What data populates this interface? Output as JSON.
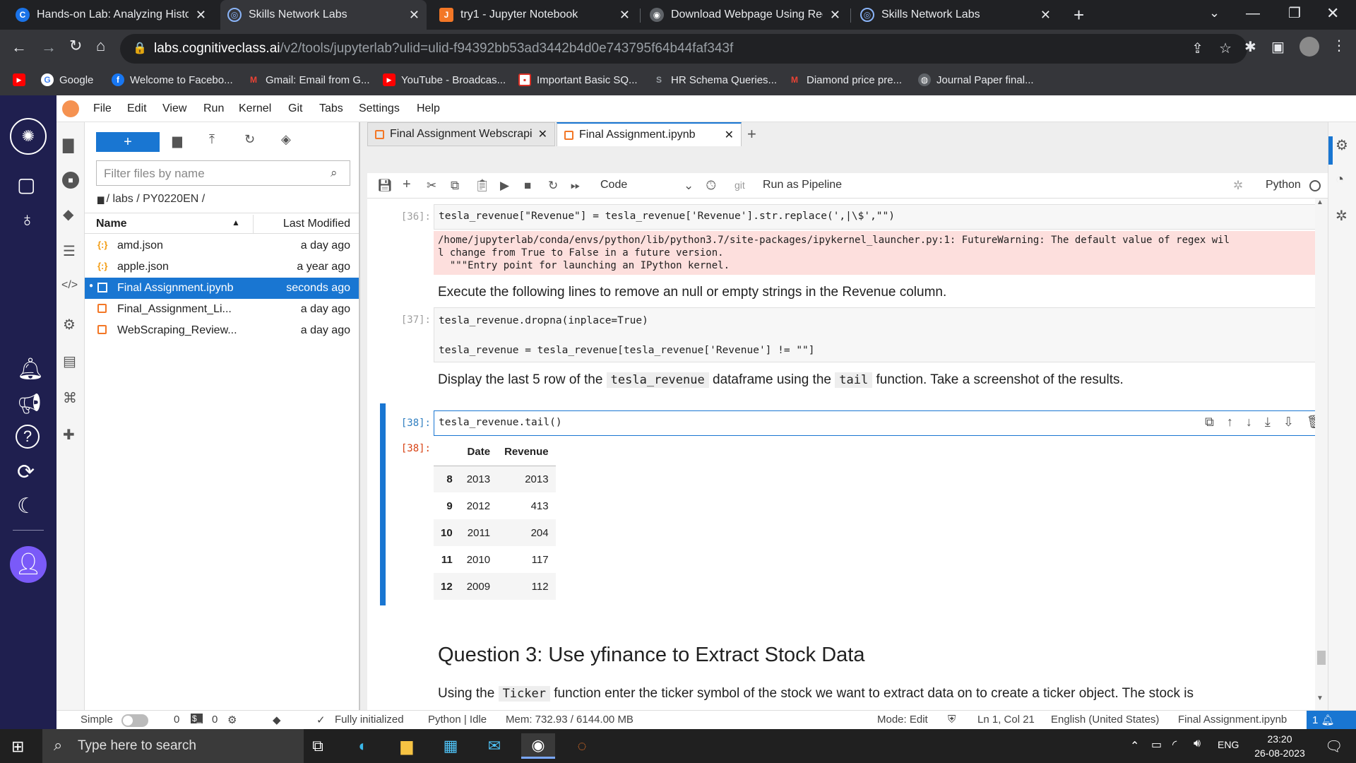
{
  "browser": {
    "tabs": [
      {
        "title": "Hands-on Lab: Analyzing Historic",
        "icon": "C"
      },
      {
        "title": "Skills Network Labs",
        "icon": "snl"
      },
      {
        "title": "try1 - Jupyter Notebook",
        "icon": "jupyter"
      },
      {
        "title": "Download Webpage Using Requ",
        "icon": "web"
      },
      {
        "title": "Skills Network Labs",
        "icon": "snl"
      }
    ],
    "url_domain": "labs.cognitiveclass.ai",
    "url_path": "/v2/tools/jupyterlab?ulid=ulid-f94392bb53ad3442b4d0e743795f64b44faf343f",
    "bookmarks": [
      {
        "label": "",
        "icon": "youtube"
      },
      {
        "label": "Google",
        "icon": "google"
      },
      {
        "label": "Welcome to Facebo...",
        "icon": "facebook"
      },
      {
        "label": "Gmail: Email from G...",
        "icon": "gmail"
      },
      {
        "label": "YouTube - Broadcas...",
        "icon": "youtube"
      },
      {
        "label": "Important Basic SQ...",
        "icon": "page"
      },
      {
        "label": "HR Schema Queries...",
        "icon": "s"
      },
      {
        "label": "Diamond price pre...",
        "icon": "gmail"
      },
      {
        "label": "Journal Paper final...",
        "icon": "globe"
      }
    ]
  },
  "menubar": [
    "File",
    "Edit",
    "View",
    "Run",
    "Kernel",
    "Git",
    "Tabs",
    "Settings",
    "Help"
  ],
  "filebrowser": {
    "new_label": "+",
    "filter_placeholder": "Filter files by name",
    "breadcrumb": "/ labs / PY0220EN /",
    "col_name": "Name",
    "col_modified": "Last Modified",
    "files": [
      {
        "name": "amd.json",
        "modified": "a day ago",
        "type": "json"
      },
      {
        "name": "apple.json",
        "modified": "a year ago",
        "type": "json"
      },
      {
        "name": "Final Assignment.ipynb",
        "modified": "seconds ago",
        "type": "notebook"
      },
      {
        "name": "Final_Assignment_Li...",
        "modified": "a day ago",
        "type": "notebook"
      },
      {
        "name": "WebScraping_Review...",
        "modified": "a day ago",
        "type": "notebook"
      }
    ]
  },
  "notebook": {
    "tabs": [
      {
        "title": "Final Assignment Webscrapi"
      },
      {
        "title": "Final Assignment.ipynb"
      }
    ],
    "toolbar": {
      "cell_type": "Code",
      "git": "git",
      "pipeline": "Run as Pipeline",
      "kernel": "Python"
    },
    "cells": {
      "c36_prompt": "[36]:",
      "c36_code_a": "tesla_revenue[\"Revenue\"] = tesla_revenue['Revenue'].str.replace(',|\\$',\"\")",
      "c36_warn_1": "/home/jupyterlab/conda/envs/python/lib/python3.7/site-packages/ipykernel_launcher.py:1: FutureWarning: The default value of regex wil",
      "c36_warn_2": "l change from True to False in a future version.",
      "c36_warn_3": "  \"\"\"Entry point for launching an IPython kernel.",
      "md1": "Execute the following lines to remove an null or empty strings in the Revenue column.",
      "c37_prompt": "[37]:",
      "c37_line1": "tesla_revenue.dropna(inplace=True)",
      "c37_line2": "tesla_revenue = tesla_revenue[tesla_revenue['Revenue'] != \"\"]",
      "md2_a": "Display the last 5 row of the",
      "md2_code1": "tesla_revenue",
      "md2_b": "dataframe using the",
      "md2_code2": "tail",
      "md2_c": "function. Take a screenshot of the results.",
      "c38_prompt": "[38]:",
      "c38_code": "tesla_revenue.tail()",
      "out38_prompt": "[38]:",
      "table_headers": [
        "",
        "Date",
        "Revenue"
      ],
      "table_rows": [
        [
          "8",
          "2013",
          "2013"
        ],
        [
          "9",
          "2012",
          "413"
        ],
        [
          "10",
          "2011",
          "204"
        ],
        [
          "11",
          "2010",
          "117"
        ],
        [
          "12",
          "2009",
          "112"
        ]
      ],
      "heading": "Question 3: Use yfinance to Extract Stock Data",
      "md3_a": "Using the",
      "md3_code": "Ticker",
      "md3_b": "function enter the ticker symbol of the stock we want to extract data on to create a ticker object. The stock is"
    }
  },
  "statusbar": {
    "simple": "Simple",
    "terminals": "0",
    "kernels": "0",
    "init": "Fully initialized",
    "kernel_state": "Python | Idle",
    "mem": "Mem: 732.93 / 6144.00 MB",
    "mode": "Mode: Edit",
    "pos": "Ln 1, Col 21",
    "lang": "English (United States)",
    "file": "Final Assignment.ipynb",
    "count": "1"
  },
  "taskbar": {
    "search_placeholder": "Type here to search",
    "lang": "ENG",
    "time": "23:20",
    "date": "26-08-2023"
  },
  "colors": {
    "jupyter_orange": "#f37726",
    "jupyter_blue": "#1976d2",
    "sidebar_navy": "#1f1f4f",
    "warning_bg": "#fddfdd"
  }
}
